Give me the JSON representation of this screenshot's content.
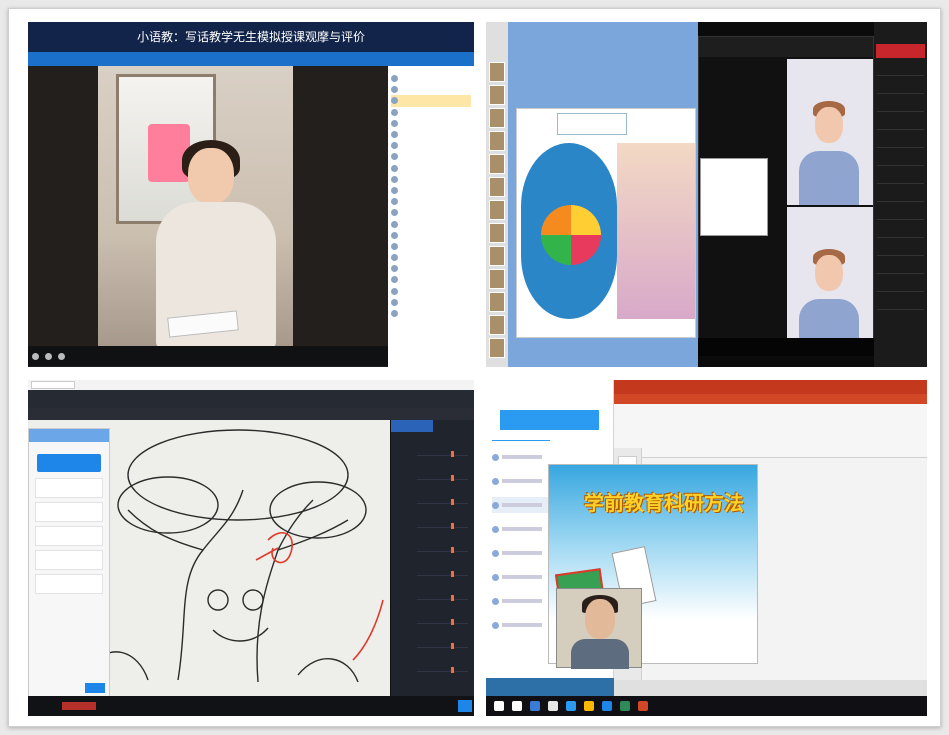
{
  "panel_video": {
    "title": "小语教：写话教学无生模拟授课观摩与评价",
    "subtitle": "",
    "poster_text": "",
    "sidebar_header": "",
    "sidebar_rows": 22,
    "end_button": ""
  },
  "panel_slides": {
    "meeting_title": "",
    "slide_logo": "",
    "slide_title": ""
  },
  "panel_drawing": {
    "tab_label": "",
    "dialog_button": "",
    "right_tabs": [
      "",
      ""
    ]
  },
  "panel_ppt": {
    "chat_button": "",
    "chat_tabs": [
      "",
      ""
    ],
    "ppt_title": "",
    "slide_title": "学前教育科研方法"
  },
  "colors": {
    "accent_blue": "#1f86e9",
    "ppt_red": "#d24726",
    "video_title_bg": "#12244a"
  }
}
